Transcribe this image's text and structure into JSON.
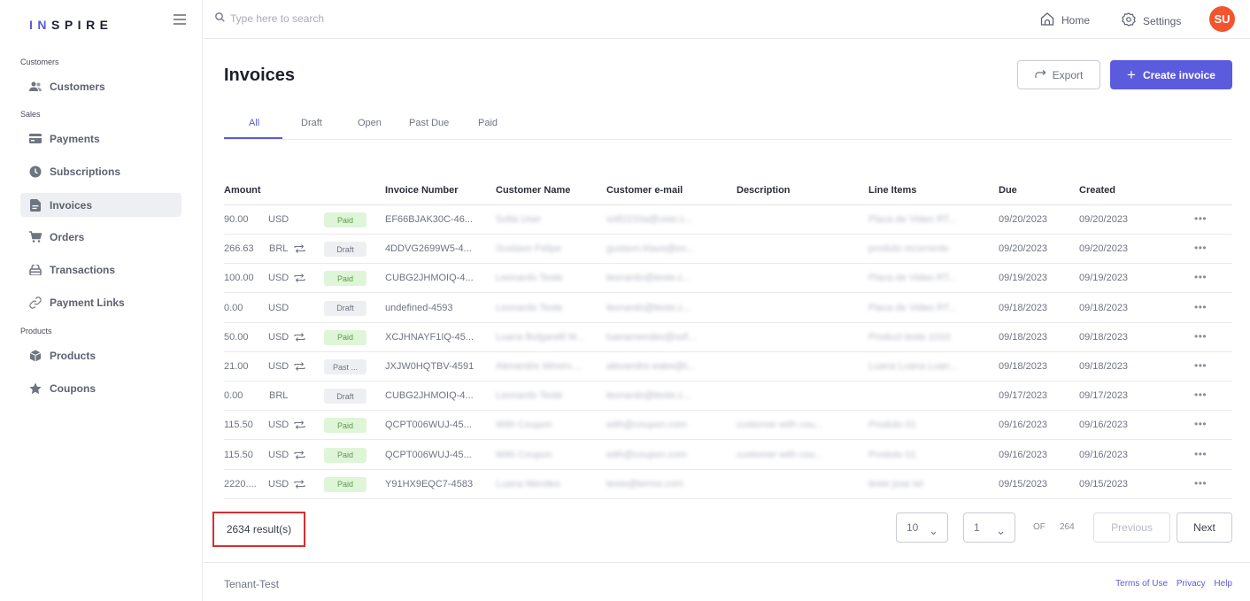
{
  "brand": {
    "logo_text_1": "IN",
    "logo_text_2": "SPIRE"
  },
  "sidebar": {
    "sections": [
      {
        "label": "Customers"
      },
      {
        "label": "Sales"
      },
      {
        "label": "Products"
      }
    ],
    "items": [
      {
        "label": "Customers",
        "icon": "users-icon"
      },
      {
        "label": "Payments",
        "icon": "credit-card-icon"
      },
      {
        "label": "Subscriptions",
        "icon": "clock-icon"
      },
      {
        "label": "Invoices",
        "icon": "document-icon",
        "active": true
      },
      {
        "label": "Orders",
        "icon": "cart-icon"
      },
      {
        "label": "Transactions",
        "icon": "wallet-icon"
      },
      {
        "label": "Payment Links",
        "icon": "link-icon"
      },
      {
        "label": "Products",
        "icon": "cube-icon"
      },
      {
        "label": "Coupons",
        "icon": "star-icon"
      }
    ]
  },
  "topbar": {
    "search_placeholder": "Type here to search",
    "home_label": "Home",
    "settings_label": "Settings",
    "avatar_initials": "SU"
  },
  "page": {
    "title": "Invoices",
    "export_label": "Export",
    "create_label": "Create invoice",
    "tabs": [
      "All",
      "Draft",
      "Open",
      "Past Due",
      "Paid"
    ],
    "active_tab": "All"
  },
  "table": {
    "headers": [
      "Amount",
      "Invoice Number",
      "Customer Name",
      "Customer e-mail",
      "Description",
      "Line Items",
      "Due",
      "Created"
    ],
    "rows": [
      {
        "amount": "90.00",
        "currency": "USD",
        "recurring": false,
        "status": "Paid",
        "invoice": "EF66BJAK30C-46...",
        "customer": "Sofia User",
        "email": "sofi2233a@user.c...",
        "description": "",
        "line_items": "Placa de Video RT...",
        "due": "09/20/2023",
        "created": "09/20/2023"
      },
      {
        "amount": "266.63",
        "currency": "BRL",
        "recurring": true,
        "status": "Draft",
        "invoice": "4DDVG2699W5-4...",
        "customer": "Gustavo Felipe",
        "email": "gustavo.klaus@ex...",
        "description": "",
        "line_items": "produto recorrente",
        "due": "09/20/2023",
        "created": "09/20/2023"
      },
      {
        "amount": "100.00",
        "currency": "USD",
        "recurring": true,
        "status": "Paid",
        "invoice": "CUBG2JHMOIQ-4...",
        "customer": "Leonardo Teste",
        "email": "leonardo@teste.c...",
        "description": "",
        "line_items": "Placa de Video RT...",
        "due": "09/19/2023",
        "created": "09/19/2023"
      },
      {
        "amount": "0.00",
        "currency": "USD",
        "recurring": false,
        "status": "Draft",
        "invoice": "undefined-4593",
        "customer": "Leonardo Teste",
        "email": "leonardo@teste.c...",
        "description": "",
        "line_items": "Placa de Video RT...",
        "due": "09/18/2023",
        "created": "09/18/2023"
      },
      {
        "amount": "50.00",
        "currency": "USD",
        "recurring": true,
        "status": "Paid",
        "invoice": "XCJHNAYF1IQ-45...",
        "customer": "Luana Bulgarelli M...",
        "email": "luanamendes@sof...",
        "description": "",
        "line_items": "Product teste 1010",
        "due": "09/18/2023",
        "created": "09/18/2023"
      },
      {
        "amount": "21.00",
        "currency": "USD",
        "recurring": true,
        "status": "Past ...",
        "invoice": "JXJW0HQTBV-4591",
        "customer": "Alexandre Minoru ...",
        "email": "alexandre.wake@t...",
        "description": "",
        "line_items": "Luana Luana Luan...",
        "due": "09/18/2023",
        "created": "09/18/2023"
      },
      {
        "amount": "0.00",
        "currency": "BRL",
        "recurring": false,
        "status": "Draft",
        "invoice": "CUBG2JHMOIQ-4...",
        "customer": "Leonardo Teste",
        "email": "leonardo@teste.c...",
        "description": "",
        "line_items": "",
        "due": "09/17/2023",
        "created": "09/17/2023"
      },
      {
        "amount": "115.50",
        "currency": "USD",
        "recurring": true,
        "status": "Paid",
        "invoice": "QCPT006WUJ-45...",
        "customer": "With Coupon",
        "email": "with@coupon.com",
        "description": "customer with cou...",
        "line_items": "Produto 01",
        "due": "09/16/2023",
        "created": "09/16/2023"
      },
      {
        "amount": "115.50",
        "currency": "USD",
        "recurring": true,
        "status": "Paid",
        "invoice": "QCPT006WUJ-45...",
        "customer": "With Coupon",
        "email": "with@coupon.com",
        "description": "customer with cou...",
        "line_items": "Produto 01",
        "due": "09/16/2023",
        "created": "09/16/2023"
      },
      {
        "amount": "2220....",
        "currency": "USD",
        "recurring": true,
        "status": "Paid",
        "invoice": "Y91HX9EQC7-4583",
        "customer": "Luana Mendes",
        "email": "teste@termo.com",
        "description": "",
        "line_items": "teste jose tel",
        "due": "09/15/2023",
        "created": "09/15/2023"
      }
    ],
    "more_label": "•••"
  },
  "pagination": {
    "results": "2634 result(s)",
    "page_size": "10",
    "current_page": "1",
    "of_label": "OF",
    "total_pages": "264",
    "previous_label": "Previous",
    "next_label": "Next"
  },
  "footer": {
    "tenant": "Tenant-Test",
    "terms": "Terms of Use",
    "privacy": "Privacy",
    "help": "Help"
  },
  "colors": {
    "accent": "#5b5bde",
    "avatar": "#f2542d",
    "paid_bg": "#dff5d8",
    "highlight_box": "#d62f2f"
  }
}
